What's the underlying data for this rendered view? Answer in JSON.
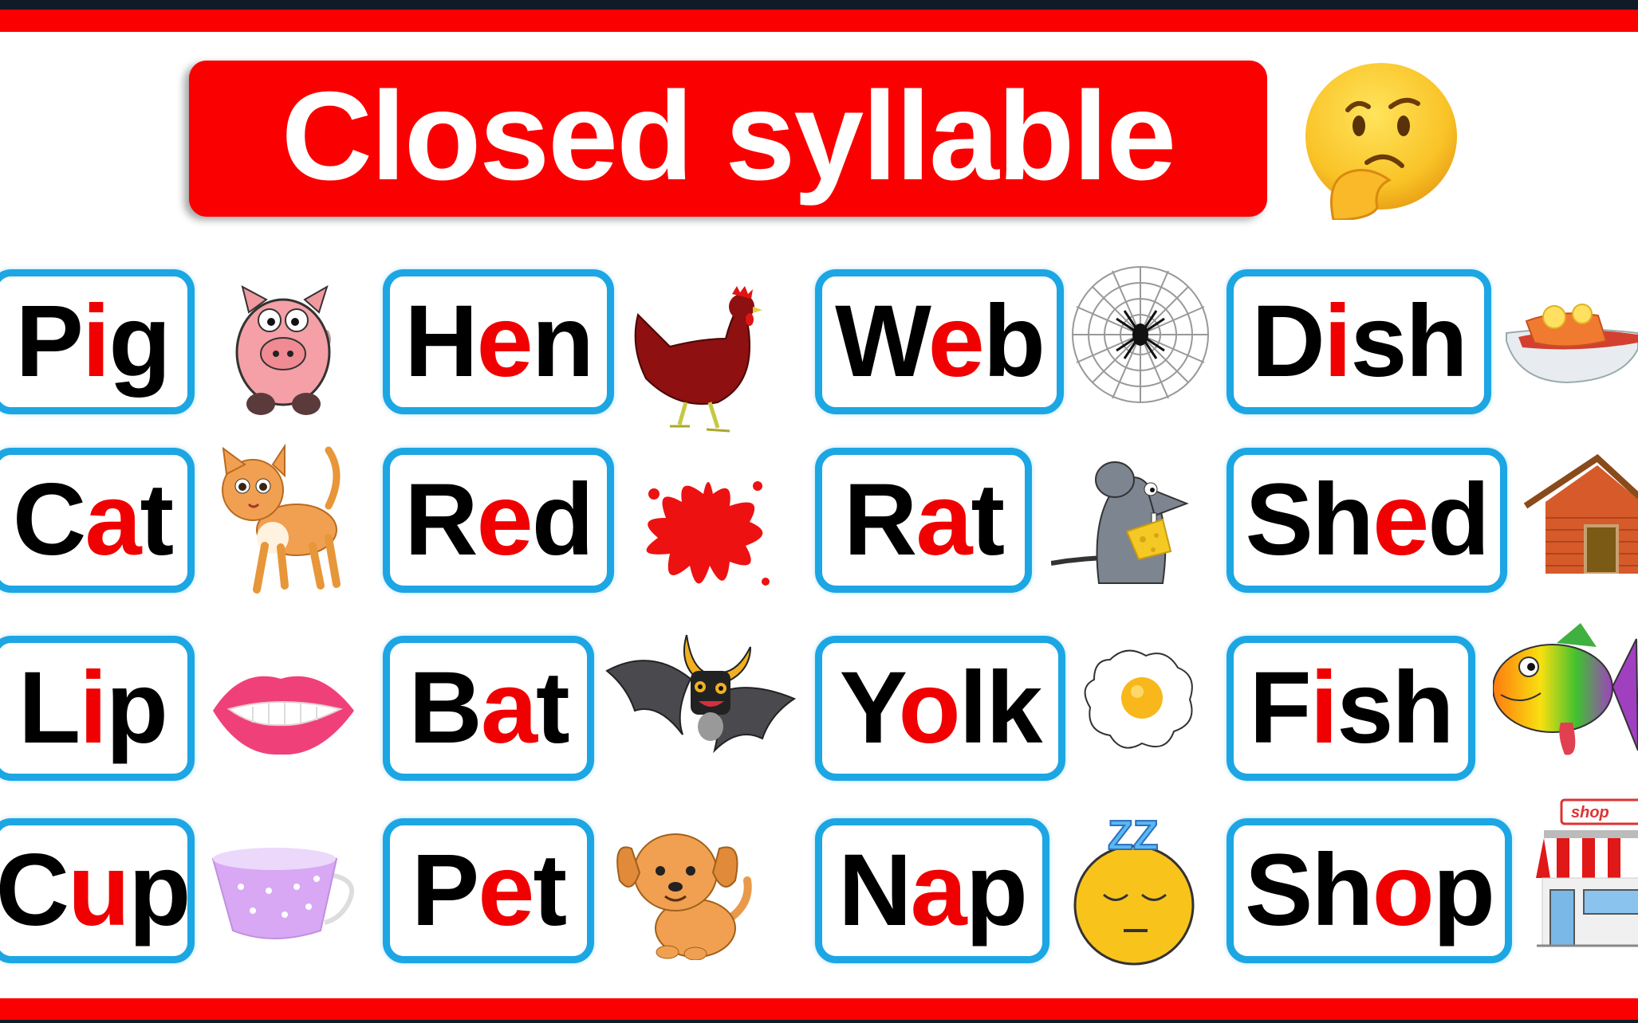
{
  "title": "Closed syllable",
  "colors": {
    "banner_red": "#fb0000",
    "card_border_blue": "#1ca6e3",
    "vowel_red": "#f00000",
    "consonant_black": "#000000",
    "frame_dark": "#111b27"
  },
  "title_icon": "thinking-face-icon",
  "words": [
    {
      "pre": "P",
      "vowel": "i",
      "post": "g",
      "icon": "pig-icon"
    },
    {
      "pre": "H",
      "vowel": "e",
      "post": "n",
      "icon": "hen-icon"
    },
    {
      "pre": "W",
      "vowel": "e",
      "post": "b",
      "icon": "spider-web-icon"
    },
    {
      "pre": "D",
      "vowel": "i",
      "post": "sh",
      "icon": "dish-icon"
    },
    {
      "pre": "C",
      "vowel": "a",
      "post": "t",
      "icon": "cat-icon"
    },
    {
      "pre": "R",
      "vowel": "e",
      "post": "d",
      "icon": "red-splash-icon"
    },
    {
      "pre": "R",
      "vowel": "a",
      "post": "t",
      "icon": "rat-icon"
    },
    {
      "pre": "Sh",
      "vowel": "e",
      "post": "d",
      "icon": "shed-icon"
    },
    {
      "pre": "L",
      "vowel": "i",
      "post": "p",
      "icon": "lips-icon"
    },
    {
      "pre": "B",
      "vowel": "a",
      "post": "t",
      "icon": "bat-icon"
    },
    {
      "pre": "Y",
      "vowel": "o",
      "post": "lk",
      "icon": "fried-egg-icon"
    },
    {
      "pre": "F",
      "vowel": "i",
      "post": "sh",
      "icon": "fish-icon"
    },
    {
      "pre": "C",
      "vowel": "u",
      "post": "p",
      "icon": "cup-icon"
    },
    {
      "pre": "P",
      "vowel": "e",
      "post": "t",
      "icon": "puppy-icon"
    },
    {
      "pre": "N",
      "vowel": "a",
      "post": "p",
      "icon": "sleeping-face-icon"
    },
    {
      "pre": "Sh",
      "vowel": "o",
      "post": "p",
      "icon": "shop-icon"
    }
  ],
  "shop_sign": "shop",
  "sleep_zz": "ZZ"
}
